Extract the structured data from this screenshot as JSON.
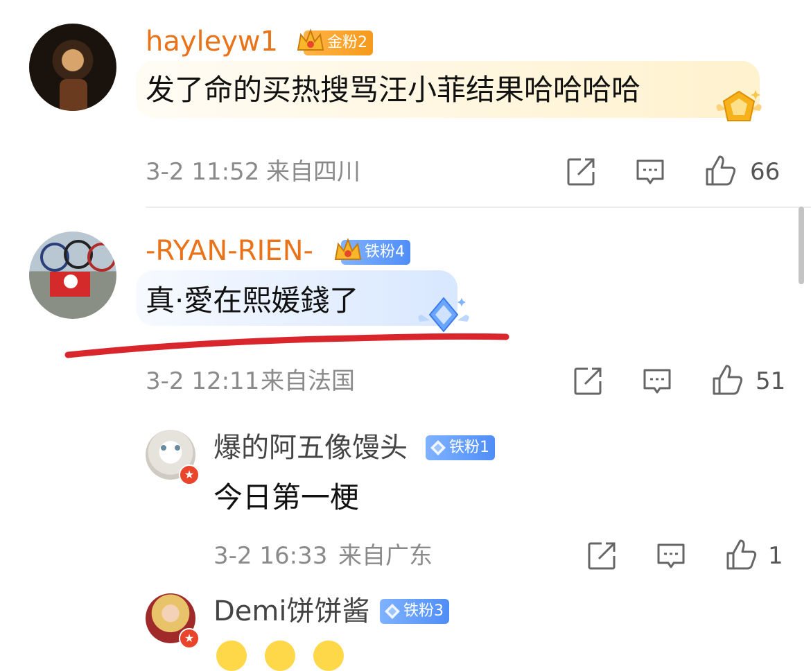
{
  "comments": [
    {
      "username": "hayleyw1",
      "badge": "金粉2",
      "text": "发了命的买热搜骂汪小菲结果哈哈哈哈",
      "time": "3-2 11:52",
      "location": "来自四川",
      "likes": "66"
    },
    {
      "username": "-RYAN-RIEN-",
      "badge": "铁粉4",
      "text": "真·愛在熙媛錢了",
      "time": "3-2 12:11",
      "location": "来自法国",
      "likes": "51"
    }
  ],
  "replies": [
    {
      "username": "爆的阿五像馒头",
      "badge": "铁粉1",
      "text": "今日第一梗",
      "time": "3-2 16:33",
      "location": "来自广东",
      "likes": "1"
    },
    {
      "username": "Demi饼饼酱",
      "badge": "铁粉3"
    }
  ],
  "icons": {
    "share": "share-icon",
    "reply": "comment-icon",
    "like": "thumbs-up-icon"
  },
  "colors": {
    "username_highlight": "#e8731a",
    "annotation_underline": "#d9262c",
    "gold_badge": "#f59a1c",
    "blue_badge": "#4f8ef7"
  }
}
